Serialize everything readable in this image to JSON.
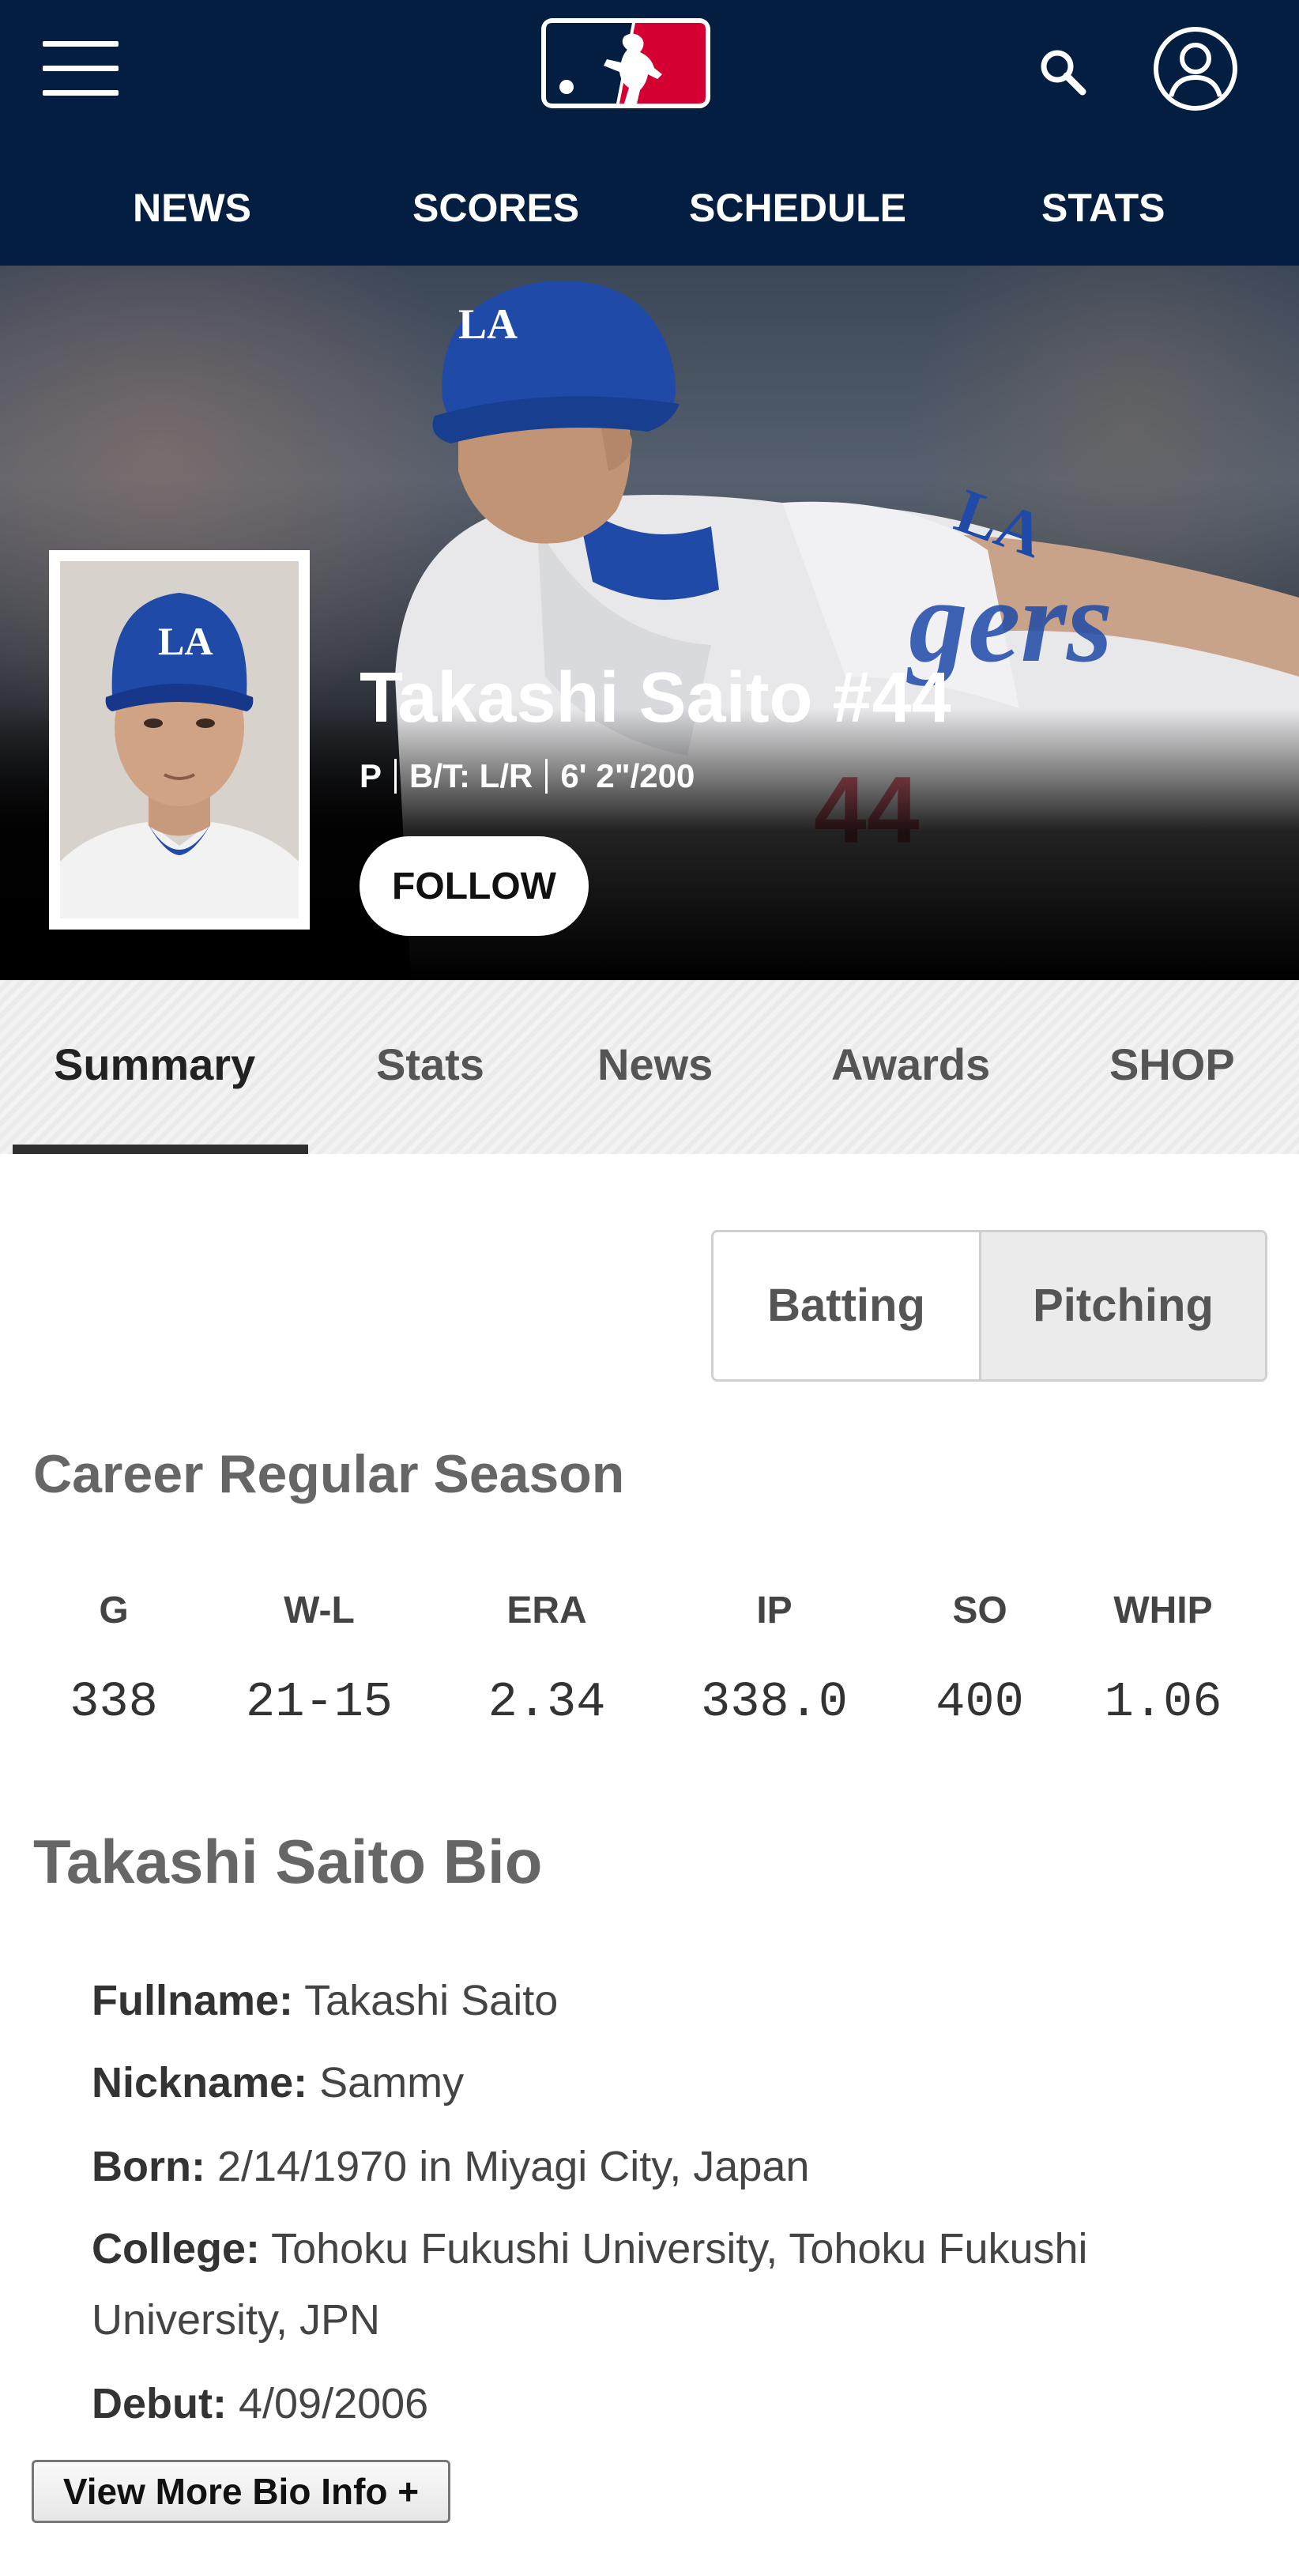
{
  "header": {
    "nav": [
      "NEWS",
      "SCORES",
      "SCHEDULE",
      "STATS"
    ],
    "icons": [
      "menu-icon",
      "mlb-logo",
      "search-icon",
      "profile-icon"
    ]
  },
  "player": {
    "name": "Takashi Saito #44",
    "position": "P",
    "bats_throws": "B/T: L/R",
    "height_weight": "6' 2\"/200",
    "follow_label": "FOLLOW"
  },
  "tabs": [
    "Summary",
    "Stats",
    "News",
    "Awards",
    "SHOP"
  ],
  "active_tab": "Summary",
  "toggle": {
    "batting": "Batting",
    "pitching": "Pitching",
    "selected": "Pitching"
  },
  "career": {
    "title": "Career Regular Season",
    "headers": [
      "G",
      "W-L",
      "ERA",
      "IP",
      "SO",
      "WHIP"
    ],
    "values": [
      "338",
      "21-15",
      "2.34",
      "338.0",
      "400",
      "1.06"
    ]
  },
  "bio": {
    "title": "Takashi Saito Bio",
    "items": [
      {
        "label": "Fullname:",
        "value": "Takashi Saito"
      },
      {
        "label": "Nickname:",
        "value": "Sammy"
      },
      {
        "label": "Born:",
        "value": "2/14/1970 in Miyagi City, Japan"
      },
      {
        "label": "College:",
        "value": "Tohoku Fukushi University, Tohoku Fukushi University, JPN"
      },
      {
        "label": "Debut:",
        "value": "4/09/2006"
      }
    ],
    "more_label": "View More Bio Info +"
  },
  "colors": {
    "navy": "#041e42",
    "mlb_red": "#d50032",
    "mlb_blue": "#041e42",
    "dodger_blue": "#1f4aa8"
  }
}
